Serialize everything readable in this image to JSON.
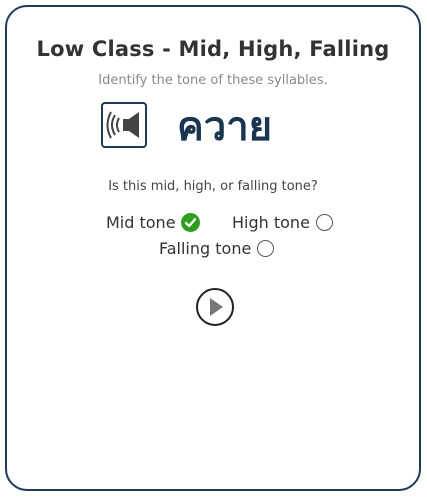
{
  "card": {
    "title": "Low Class - Mid, High, Falling",
    "subtitle": "Identify the tone of these syllables.",
    "word": "ควาย",
    "question": "Is this mid, high, or falling tone?",
    "options": [
      {
        "label": "Mid tone",
        "state": "correct"
      },
      {
        "label": "High tone",
        "state": "unselected"
      },
      {
        "label": "Falling tone",
        "state": "unselected"
      }
    ],
    "icons": {
      "audio": "speaker-icon",
      "play": "play-icon",
      "correct": "check-icon"
    },
    "colors": {
      "border": "#1f3b5a",
      "word": "#1a3550",
      "correct": "#2f9e1f"
    }
  }
}
